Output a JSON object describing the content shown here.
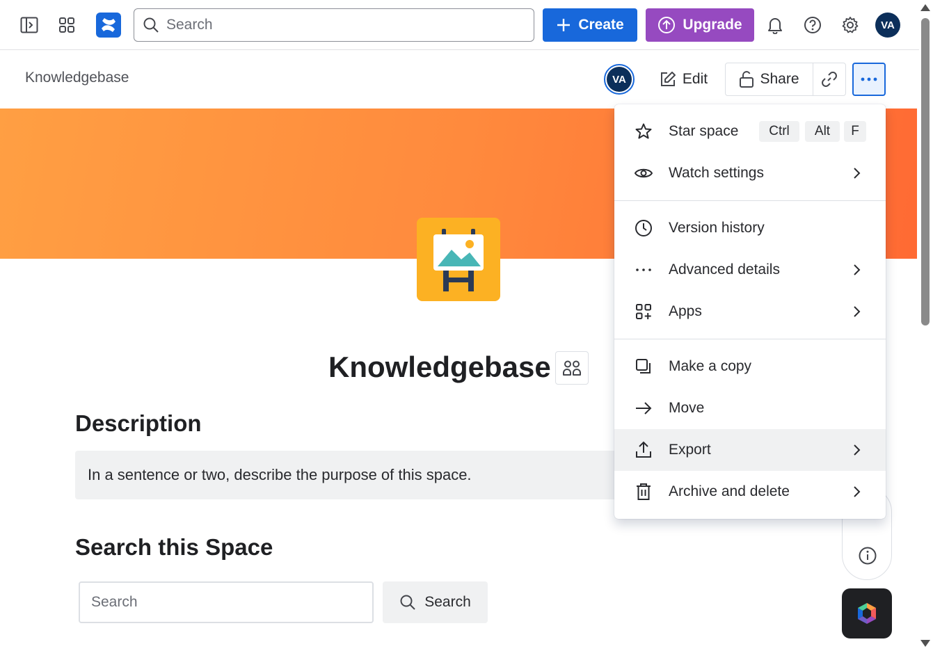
{
  "topnav": {
    "search_placeholder": "Search",
    "create_label": "Create",
    "upgrade_label": "Upgrade",
    "avatar_initials": "VA"
  },
  "header": {
    "breadcrumb": "Knowledgebase",
    "avatar_initials": "VA",
    "edit_label": "Edit",
    "share_label": "Share"
  },
  "space": {
    "title": "Knowledgebase",
    "description_heading": "Description",
    "description_text": "In a sentence or two, describe the purpose of this space.",
    "search_heading": "Search this Space",
    "search_placeholder": "Search",
    "search_button": "Search"
  },
  "menu": {
    "star_label": "Star space",
    "star_shortcut": [
      "Ctrl",
      "Alt",
      "F"
    ],
    "watch_label": "Watch settings",
    "version_label": "Version history",
    "advanced_label": "Advanced details",
    "apps_label": "Apps",
    "copy_label": "Make a copy",
    "move_label": "Move",
    "export_label": "Export",
    "archive_label": "Archive and delete"
  },
  "colors": {
    "brand_blue": "#1868db",
    "upgrade_purple": "#964ac0",
    "banner_orange": "#ff8a3d",
    "space_icon_yellow": "#fcb123",
    "avatar_navy": "#0c2f5a"
  },
  "icons": {
    "sidebar_toggle": "sidebar-toggle-icon",
    "app_switcher": "app-switcher-icon",
    "notifications": "bell-icon",
    "help": "help-icon",
    "settings": "gear-icon"
  }
}
